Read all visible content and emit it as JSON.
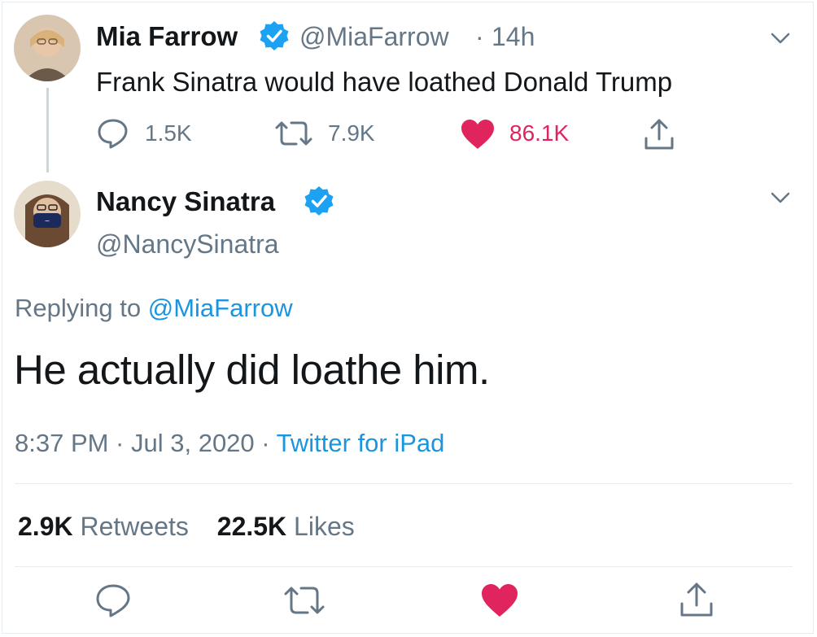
{
  "colors": {
    "text": "#14171a",
    "muted": "#657786",
    "link": "#1b95e0",
    "like": "#e0245e",
    "verified": "#1da1f2"
  },
  "parent_tweet": {
    "name": "Mia Farrow",
    "handle": "@MiaFarrow",
    "dot": "·",
    "time": "14h",
    "text": "Frank Sinatra would have loathed Donald Trump",
    "reply_count": "1.5K",
    "retweet_count": "7.9K",
    "like_count": "86.1K",
    "liked": true
  },
  "main_tweet": {
    "name": "Nancy Sinatra",
    "handle": "@NancySinatra",
    "replying_prefix": "Replying to",
    "replying_to": "@MiaFarrow",
    "text": "He actually did loathe him.",
    "timestamp": "8:37 PM · Jul 3, 2020 ·",
    "source": "Twitter for iPad",
    "retweets_count": "2.9K",
    "retweets_label": "Retweets",
    "likes_count": "22.5K",
    "likes_label": "Likes",
    "liked": true
  },
  "icons": {
    "reply": "speech-bubble-icon",
    "retweet": "retweet-arrows-icon",
    "like": "heart-icon",
    "share": "share-upload-icon",
    "verified": "verified-badge-icon",
    "menu": "chevron-down-icon"
  }
}
